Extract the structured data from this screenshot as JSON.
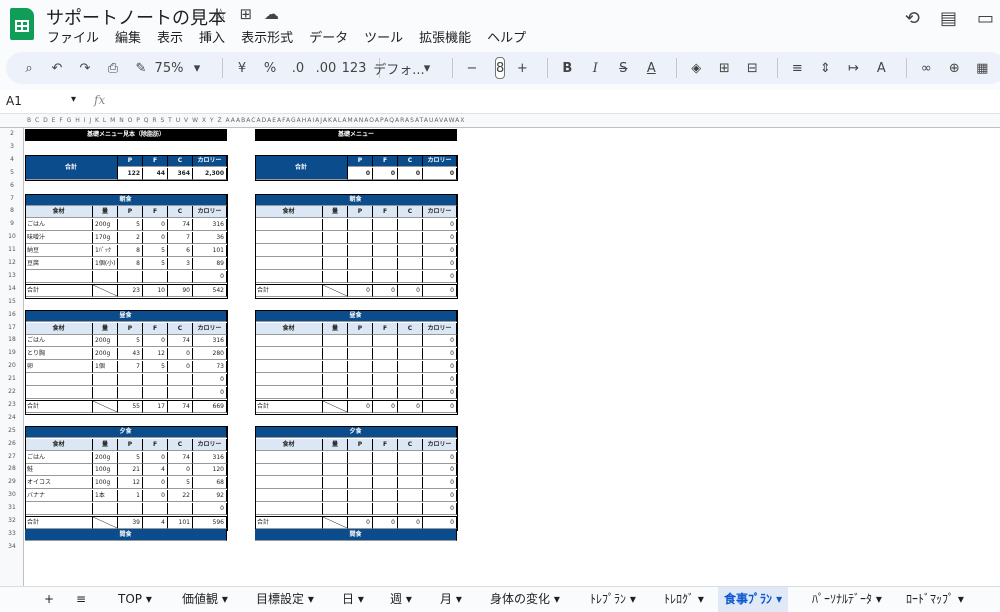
{
  "app": {
    "title": "サポートノートの見本",
    "icon": "sheets-icon"
  },
  "menu": [
    "ファイル",
    "編集",
    "表示",
    "挿入",
    "表示形式",
    "データ",
    "ツール",
    "拡張機能",
    "ヘルプ"
  ],
  "toolbar": {
    "zoom": "75%",
    "currency": "¥",
    "percent": "%",
    "dec_less": ".0",
    "dec_more": ".00",
    "number_fmt": "123",
    "font": "デフォ...",
    "font_size": "8"
  },
  "formula": {
    "cell_ref": "A1",
    "fx": "fx"
  },
  "columns": "B C D E F G H I J K L M N O P Q R S T U V W X Y Z AAABACADAEAFAGAHAIAJAKALAMANAOAPAQARASATAUAVAWAX",
  "rows": [
    "2",
    "3",
    "4",
    "5",
    "6",
    "7",
    "8",
    "9",
    "10",
    "11",
    "12",
    "13",
    "14",
    "15",
    "16",
    "17",
    "18",
    "19",
    "20",
    "21",
    "22",
    "23",
    "24",
    "25",
    "26",
    "27",
    "28",
    "29",
    "30",
    "31",
    "32",
    "33",
    "34"
  ],
  "left": {
    "title": "基礎メニュー見本（除脂肪）",
    "total_label": "合計",
    "summary_headers": [
      "P",
      "F",
      "C",
      "カロリー"
    ],
    "summary_values": [
      "122",
      "44",
      "364",
      "2,300"
    ],
    "meals": [
      {
        "name": "朝食",
        "headers": [
          "食材",
          "量",
          "P",
          "F",
          "C",
          "カロリー"
        ],
        "rows": [
          [
            "ごはん",
            "200g",
            "5",
            "0",
            "74",
            "316"
          ],
          [
            "味噌汁",
            "170g",
            "2",
            "0",
            "7",
            "36"
          ],
          [
            "納豆",
            "1ﾊﾟｯｸ",
            "8",
            "5",
            "6",
            "101"
          ],
          [
            "豆腐",
            "1個(小)",
            "8",
            "5",
            "3",
            "89"
          ],
          [
            "",
            "",
            "",
            "",
            "",
            "0"
          ]
        ],
        "total": [
          "合計",
          "",
          "23",
          "10",
          "90",
          "542"
        ]
      },
      {
        "name": "昼食",
        "headers": [
          "食材",
          "量",
          "P",
          "F",
          "C",
          "カロリー"
        ],
        "rows": [
          [
            "ごはん",
            "200g",
            "5",
            "0",
            "74",
            "316"
          ],
          [
            "とり胸",
            "200g",
            "43",
            "12",
            "0",
            "280"
          ],
          [
            "卵",
            "1個",
            "7",
            "5",
            "0",
            "73"
          ],
          [
            "",
            "",
            "",
            "",
            "",
            "0"
          ],
          [
            "",
            "",
            "",
            "",
            "",
            "0"
          ]
        ],
        "total": [
          "合計",
          "",
          "55",
          "17",
          "74",
          "669"
        ]
      },
      {
        "name": "夕食",
        "headers": [
          "食材",
          "量",
          "P",
          "F",
          "C",
          "カロリー"
        ],
        "rows": [
          [
            "ごはん",
            "200g",
            "5",
            "0",
            "74",
            "316"
          ],
          [
            "鮭",
            "100g",
            "21",
            "4",
            "0",
            "120"
          ],
          [
            "オイコス",
            "100g",
            "12",
            "0",
            "5",
            "68"
          ],
          [
            "バナナ",
            "1本",
            "1",
            "0",
            "22",
            "92"
          ],
          [
            "",
            "",
            "",
            "",
            "",
            "0"
          ]
        ],
        "total": [
          "合計",
          "",
          "39",
          "4",
          "101",
          "596"
        ]
      },
      {
        "name": "間食",
        "headers": [],
        "rows": [],
        "total": []
      }
    ]
  },
  "right": {
    "title": "基礎メニュー",
    "total_label": "合計",
    "summary_headers": [
      "P",
      "F",
      "C",
      "カロリー"
    ],
    "summary_values": [
      "0",
      "0",
      "0",
      "0"
    ],
    "meals": [
      {
        "name": "朝食",
        "headers": [
          "食材",
          "量",
          "P",
          "F",
          "C",
          "カロリー"
        ],
        "rows": [
          [
            "",
            "",
            "",
            "",
            "",
            "0"
          ],
          [
            "",
            "",
            "",
            "",
            "",
            "0"
          ],
          [
            "",
            "",
            "",
            "",
            "",
            "0"
          ],
          [
            "",
            "",
            "",
            "",
            "",
            "0"
          ],
          [
            "",
            "",
            "",
            "",
            "",
            "0"
          ]
        ],
        "total": [
          "合計",
          "",
          "0",
          "0",
          "0",
          "0"
        ]
      },
      {
        "name": "昼食",
        "headers": [
          "食材",
          "量",
          "P",
          "F",
          "C",
          "カロリー"
        ],
        "rows": [
          [
            "",
            "",
            "",
            "",
            "",
            "0"
          ],
          [
            "",
            "",
            "",
            "",
            "",
            "0"
          ],
          [
            "",
            "",
            "",
            "",
            "",
            "0"
          ],
          [
            "",
            "",
            "",
            "",
            "",
            "0"
          ],
          [
            "",
            "",
            "",
            "",
            "",
            "0"
          ]
        ],
        "total": [
          "合計",
          "",
          "0",
          "0",
          "0",
          "0"
        ]
      },
      {
        "name": "夕食",
        "headers": [
          "食材",
          "量",
          "P",
          "F",
          "C",
          "カロリー"
        ],
        "rows": [
          [
            "",
            "",
            "",
            "",
            "",
            "0"
          ],
          [
            "",
            "",
            "",
            "",
            "",
            "0"
          ],
          [
            "",
            "",
            "",
            "",
            "",
            "0"
          ],
          [
            "",
            "",
            "",
            "",
            "",
            "0"
          ],
          [
            "",
            "",
            "",
            "",
            "",
            "0"
          ]
        ],
        "total": [
          "合計",
          "",
          "0",
          "0",
          "0",
          "0"
        ]
      },
      {
        "name": "間食",
        "headers": [],
        "rows": [],
        "total": []
      }
    ]
  },
  "tabs": [
    {
      "label": "+",
      "active": false
    },
    {
      "label": "≡",
      "active": false
    },
    {
      "label": "TOP ▾",
      "active": false
    },
    {
      "label": "価値観 ▾",
      "active": false
    },
    {
      "label": "目標設定 ▾",
      "active": false
    },
    {
      "label": "日 ▾",
      "active": false
    },
    {
      "label": "週 ▾",
      "active": false
    },
    {
      "label": "月 ▾",
      "active": false
    },
    {
      "label": "身体の変化 ▾",
      "active": false
    },
    {
      "label": "ﾄﾚﾌﾟﾗﾝ ▾",
      "active": false
    },
    {
      "label": "ﾄﾚﾛｸﾞ ▾",
      "active": false
    },
    {
      "label": "食事ﾌﾟﾗﾝ ▾",
      "active": true
    },
    {
      "label": "ﾊﾟｰｿﾅﾙﾃﾞｰﾀ ▾",
      "active": false
    },
    {
      "label": "ﾛｰﾄﾞﾏｯﾌﾟ ▾",
      "active": false
    }
  ]
}
